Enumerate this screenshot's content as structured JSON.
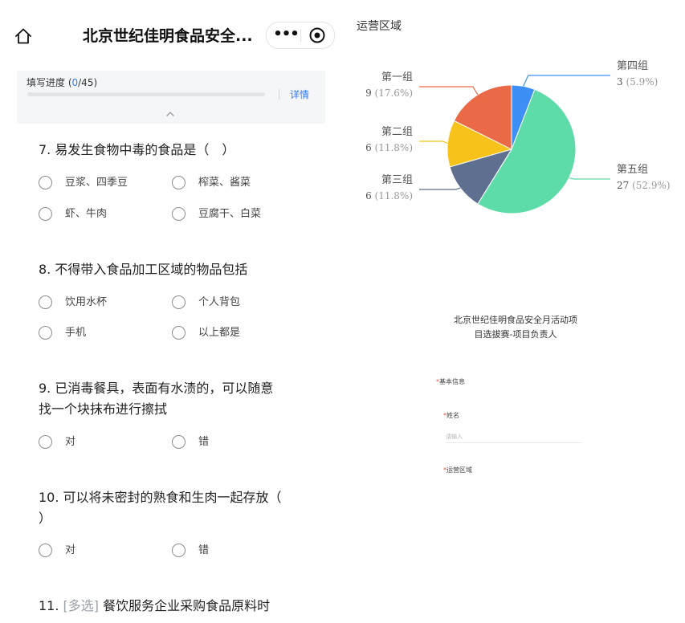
{
  "navbar": {
    "title": "北京世纪佳明食品安全...",
    "more_glyph": "•••"
  },
  "progress": {
    "label_prefix": "填写进度 (",
    "current": "0",
    "label_suffix": "/45)",
    "fraction": 0,
    "detail": "详情"
  },
  "questions": [
    {
      "title": "7. 易发生食物中毒的食品是（　）",
      "options": [
        "豆浆、四季豆",
        "榨菜、酱菜",
        "虾、牛肉",
        "豆腐干、白菜"
      ]
    },
    {
      "title": "8. 不得带入食品加工区域的物品包括",
      "options": [
        "饮用水杯",
        "个人背包",
        "手机",
        "以上都是"
      ]
    },
    {
      "title_line1": "9. 已消毒餐具，表面有水渍的，可以随意",
      "title_line2": "找一个块抹布进行擦拭",
      "options": [
        "对",
        "错"
      ]
    },
    {
      "title_line1": "10. 可以将未密封的熟食和生肉一起存放（",
      "title_line2": "）",
      "options": [
        "对",
        "错"
      ]
    },
    {
      "number": "11.",
      "tag": "[多选]",
      "title": "餐饮服务企业采购食品原料时"
    }
  ],
  "chart_title": "运营区域",
  "chart_data": {
    "type": "pie",
    "title": "运营区域",
    "slices": [
      {
        "name": "第四组",
        "value": 3,
        "percent": "5.9%",
        "color": "#3d8ff5"
      },
      {
        "name": "第五组",
        "value": 27,
        "percent": "52.9%",
        "color": "#5ddba8"
      },
      {
        "name": "第三组",
        "value": 6,
        "percent": "11.8%",
        "color": "#5f6f8f"
      },
      {
        "name": "第二组",
        "value": 6,
        "percent": "11.8%",
        "color": "#f7c21a"
      },
      {
        "name": "第一组",
        "value": 9,
        "percent": "17.6%",
        "color": "#ea6a48"
      }
    ]
  },
  "form_preview": {
    "title_line1": "北京世纪佳明食品安全月活动项",
    "title_line2": "目选拔赛-项目负责人",
    "required_mark": "*",
    "section_label": "基本信息",
    "name_label": "姓名",
    "name_placeholder": "请输入",
    "region_label": "运营区域"
  }
}
